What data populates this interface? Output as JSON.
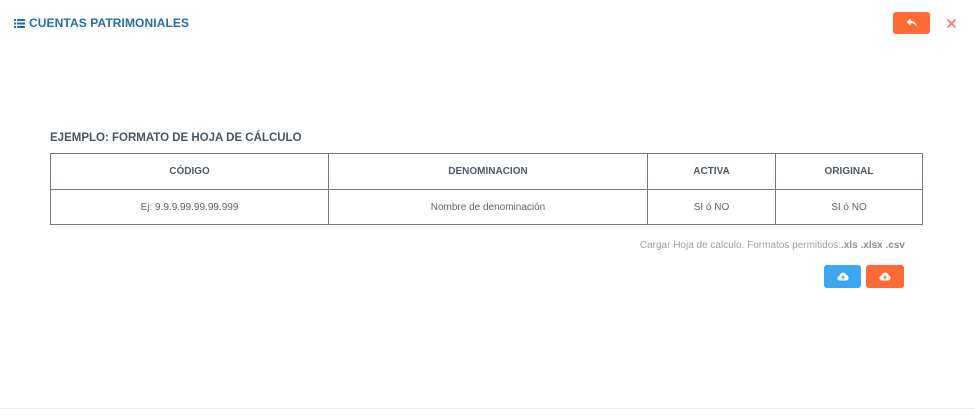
{
  "header": {
    "title": "CUENTAS PATRIMONIALES",
    "title_icon": "list-icon",
    "back_icon": "reply-icon",
    "close_icon": "close-icon"
  },
  "example": {
    "title": "EJEMPLO: FORMATO DE HOJA DE CÁLCULO",
    "columns": [
      "CÓDIGO",
      "DENOMINACION",
      "ACTIVA",
      "ORIGINAL"
    ],
    "row": [
      "Ej: 9.9.9.99.99.99.999",
      "Nombre de denominación",
      "SI ó NO",
      "SI ó NO"
    ]
  },
  "upload": {
    "note": "Cargar Hoja de calculo. Formatos permitidos:",
    "formats": ".xls .xlsx .csv",
    "upload_icon": "cloud-upload-icon"
  },
  "colors": {
    "accent_orange": "#fd6a33",
    "accent_blue": "#3ba7f2",
    "title_blue": "#1f6fa8",
    "close_red": "#f07b7b"
  }
}
